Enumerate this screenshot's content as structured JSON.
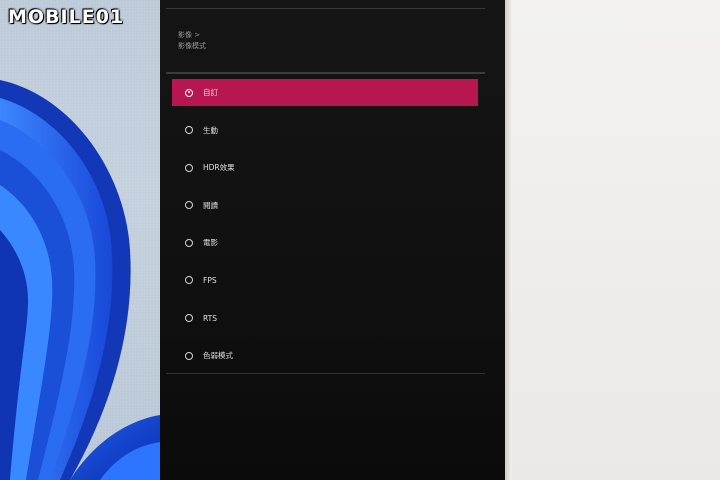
{
  "watermark": "MOBILE01",
  "osd": {
    "breadcrumb_parent": "影像 >",
    "breadcrumb_current": "影像模式",
    "options": [
      {
        "label": "自訂",
        "selected": true
      },
      {
        "label": "生動",
        "selected": false
      },
      {
        "label": "HDR效果",
        "selected": false
      },
      {
        "label": "閱讀",
        "selected": false
      },
      {
        "label": "電影",
        "selected": false
      },
      {
        "label": "FPS",
        "selected": false
      },
      {
        "label": "RTS",
        "selected": false
      },
      {
        "label": "色弱模式",
        "selected": false
      }
    ],
    "accent_color": "#b81650"
  }
}
